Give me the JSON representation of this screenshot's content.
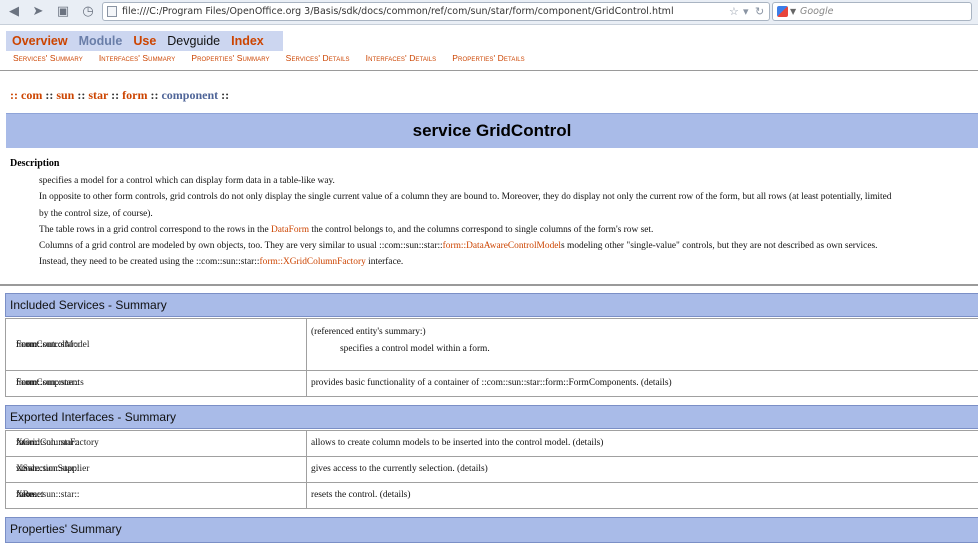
{
  "browser": {
    "url": "file:///C:/Program Files/OpenOffice.org 3/Basis/sdk/docs/common/ref/com/sun/star/form/component/GridControl.html",
    "search_placeholder": "Google"
  },
  "nav": {
    "overview": "Overview",
    "module": "Module",
    "use": "Use",
    "devguide": "Devguide",
    "index": "Index"
  },
  "subnav": {
    "services_summary": "Services' Summary",
    "interfaces_summary": "Interfaces' Summary",
    "properties_summary": "Properties' Summary",
    "services_details": "Services' Details",
    "interfaces_details": "Interfaces' Details",
    "properties_details": "Properties' Details"
  },
  "breadcrumb": {
    "sep": "::",
    "com": "com",
    "sun": "sun",
    "star": "star",
    "form": "form",
    "component": "component"
  },
  "title": "service GridControl",
  "description": {
    "label": "Description",
    "p1": "specifies a model for a control which can display form data in a table-like way.",
    "p2a": "In opposite to other form controls, grid controls do not only display the single current value of a column they are bound to. Moreover, they do display not only the current row of the form, but all rows (at least potentially, limited",
    "p2b": "by the control size, of course).",
    "p3_pre": "The table rows in a grid control correspond to the rows in the ",
    "p3_link": "DataForm",
    "p3_post": " the control belongs to, and the columns correspond to single columns of the form's row set.",
    "p4_pre": "Columns of a grid control are modeled by own objects, too. They are very similar to usual ::com::sun::star::",
    "p4_link1": "form::DataAwareControlModel",
    "p4_mid": "s modeling other \"single-value\" controls, but they are not described as own services.",
    "p4b_pre": "Instead, they need to be created using the ::com::sun::star::",
    "p4b_link": "form::XGridColumnFactory",
    "p4b_post": " interface."
  },
  "included_services": {
    "header": "Included Services - Summary",
    "rows": [
      {
        "prefix": "::com::sun::star::",
        "module": "form::",
        "name": "FormControlModel",
        "desc_line1": "(referenced entity's summary:)",
        "desc_line2": "specifies a control model within a form."
      },
      {
        "prefix": "::com::sun::star::",
        "module": "form::",
        "name": "FormComponents",
        "desc_pre": "provides basic functionality of a container of ::com::sun::star::",
        "desc_link_module": "form::",
        "desc_link_name": "FormComponent",
        "desc_post": "s. (",
        "details": "details",
        "desc_end": ")"
      }
    ]
  },
  "exported_interfaces": {
    "header": "Exported Interfaces - Summary",
    "rows": [
      {
        "prefix": "::com::sun::star::",
        "module": "form::",
        "name": "XGridColumnFactory",
        "desc": "allows to create column models to be inserted into the control model. (",
        "details": "details",
        "end": ")"
      },
      {
        "prefix": "::com::sun::star::",
        "module": "view::",
        "name": "XSelectionSupplier",
        "desc": "gives access to the currently selection. (",
        "details": "details",
        "end": ")"
      },
      {
        "prefix": "::com::sun::star::",
        "module": "form::",
        "name": "XReset",
        "desc": "resets the control. (",
        "details": "details",
        "end": ")"
      }
    ]
  },
  "properties_summary": {
    "header": "Properties' Summary"
  }
}
